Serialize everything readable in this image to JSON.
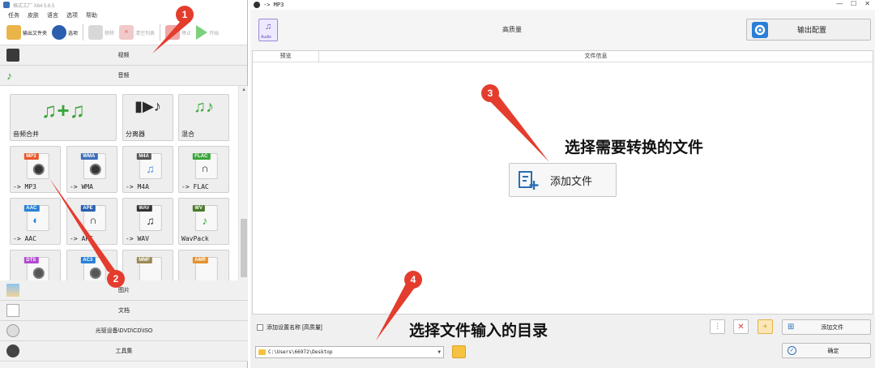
{
  "left_window": {
    "title": "格式工厂 X64 5.6.5",
    "menu": [
      "任务",
      "皮肤",
      "语言",
      "选项",
      "帮助"
    ],
    "toolbar": [
      {
        "label": "输出文件夹",
        "icon": "folder-icon",
        "enabled": true
      },
      {
        "label": "选项",
        "icon": "options-icon",
        "enabled": true
      },
      {
        "label": "移除",
        "icon": "remove-icon",
        "enabled": false
      },
      {
        "label": "清空列表",
        "icon": "clear-icon",
        "enabled": false
      },
      {
        "label": "停止",
        "icon": "stop-icon",
        "enabled": false
      },
      {
        "label": "开始",
        "icon": "start-icon",
        "enabled": false
      }
    ],
    "categories_top": [
      {
        "label": "视频",
        "icon": "video-icon"
      },
      {
        "label": "音频",
        "icon": "audio-icon"
      }
    ],
    "audio_tiles": [
      {
        "label": "音频合并",
        "icon": "audio-join-icon"
      },
      {
        "label": "分离器",
        "icon": "splitter-icon"
      },
      {
        "label": "混合",
        "icon": "mix-icon"
      },
      {
        "label": "-> MP3",
        "tag": "MP3",
        "tag_color": "#e7572b"
      },
      {
        "label": "-> WMA",
        "tag": "WMA",
        "tag_color": "#3e6fb8"
      },
      {
        "label": "-> M4A",
        "tag": "M4A",
        "tag_color": "#555555"
      },
      {
        "label": "-> FLAC",
        "tag": "FLAC",
        "tag_color": "#3aa63a"
      },
      {
        "label": "-> AAC",
        "tag": "AAC",
        "tag_color": "#2a82d6"
      },
      {
        "label": "-> APE",
        "tag": "APE",
        "tag_color": "#2a5fb0"
      },
      {
        "label": "-> WAV",
        "tag": "WAV",
        "tag_color": "#333333"
      },
      {
        "label": "WavPack",
        "tag": "WV",
        "tag_color": "#4a7a2a"
      },
      {
        "label": "",
        "tag": "DTS",
        "tag_color": "#b04acf"
      },
      {
        "label": "",
        "tag": "AC3",
        "tag_color": "#2a7fd6"
      },
      {
        "label": "",
        "tag": "MMF",
        "tag_color": "#9a8a55"
      },
      {
        "label": "",
        "tag": "AMR",
        "tag_color": "#e3902a"
      }
    ],
    "categories_bottom": [
      {
        "label": "图片",
        "icon": "picture-icon"
      },
      {
        "label": "文档",
        "icon": "document-icon"
      },
      {
        "label": "光驱设备\\DVD\\CD\\ISO",
        "icon": "disc-icon"
      },
      {
        "label": "工具集",
        "icon": "tools-icon"
      }
    ]
  },
  "right_window": {
    "title": "-> MP3",
    "badge_label": "Audio",
    "quality": "高质量",
    "output_config_label": "输出配置",
    "columns": [
      "预览",
      "文件信息"
    ],
    "add_file_center_label": "添加文件",
    "checkbox_label": "添加设置名称 [高质量]",
    "path_value": "C:\\Users\\66972\\Desktop",
    "add_file_label": "添加文件",
    "ok_label": "确定"
  },
  "annotations": {
    "n1": "1",
    "n2": "2",
    "n3": "3",
    "n4": "4",
    "text3": "选择需要转换的文件",
    "text4": "选择文件输入的目录"
  },
  "colors": {
    "marker": "#e43c2d",
    "accent_blue": "#2a6fb3"
  }
}
